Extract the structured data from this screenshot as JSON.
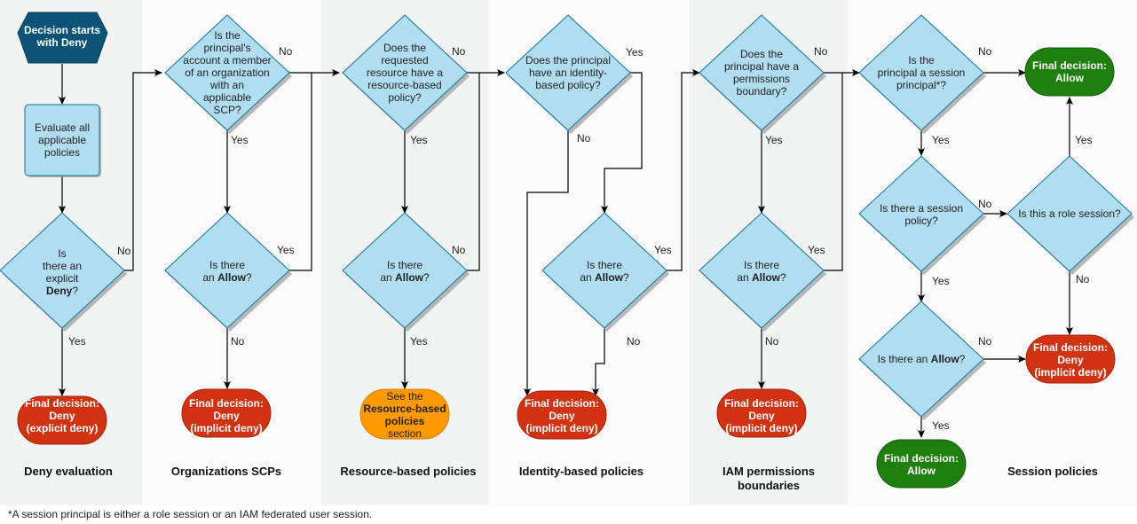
{
  "colors": {
    "diamond_fill": "#b1ddf0",
    "diamond_stroke": "#10739e",
    "start_fill": "#0d5377",
    "evaluate_fill": "#b1ddf0",
    "deny_fill": "#d13212",
    "allow_fill": "#1e7e0e",
    "see_fill": "#ff9900"
  },
  "start": {
    "line1": "Decision starts",
    "line2": "with Deny"
  },
  "evaluate": {
    "line1": "Evaluate all",
    "line2": "applicable",
    "line3": "policies"
  },
  "sections": {
    "deny": "Deny evaluation",
    "scp": "Organizations SCPs",
    "rbp": "Resource-based policies",
    "ibp": "Identity-based policies",
    "pb1": "IAM permissions",
    "pb2": "boundaries",
    "session": "Session policies"
  },
  "questions": {
    "explicit_deny": {
      "l1": "Is",
      "l2": "there an",
      "l3": "explicit",
      "l4": "Deny",
      "l4b": "?"
    },
    "scp_member": {
      "l1": "Is the",
      "l2": "principal's",
      "l3": "account a member",
      "l4": "of an organization",
      "l5": "with an",
      "l6": "applicable",
      "l7": "SCP?"
    },
    "allow": {
      "l1": "Is there",
      "l2a": "an ",
      "l2b": "Allow",
      "l2c": "?"
    },
    "rbp_has": {
      "l1": "Does the",
      "l2": "requested",
      "l3": "resource have a",
      "l4": "resource-based",
      "l5": "policy?"
    },
    "ibp_has": {
      "l1": "Does the principal",
      "l2": "have an identity-",
      "l3": "based policy?"
    },
    "pb_has": {
      "l1": "Does the",
      "l2": "principal have a",
      "l3": "permissions",
      "l4": "boundary?"
    },
    "session_principal": {
      "l1": "Is the",
      "l2": "principal a session",
      "l3": "principal*?"
    },
    "session_policy": {
      "l1": "Is there a session",
      "l2": "policy?"
    },
    "role_session": {
      "l1": "Is this a role session?"
    },
    "session_allow": {
      "l1a": "Is there an ",
      "l1b": "Allow",
      "l1c": "?"
    }
  },
  "edge_labels": {
    "yes": "Yes",
    "no": "No"
  },
  "outcomes": {
    "final": "Final decision:",
    "deny": "Deny",
    "allow": "Allow",
    "explicit": "(explicit deny)",
    "implicit": "(implicit deny)",
    "see": {
      "l1": "See the",
      "l2": "Resource-based",
      "l3": "policies",
      "l4": "section"
    }
  },
  "footnote": "*A session principal is either a role session or an IAM federated user session."
}
